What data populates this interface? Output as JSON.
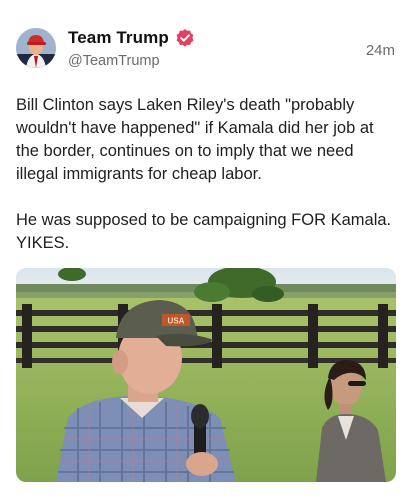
{
  "post": {
    "author": {
      "display_name": "Team Trump",
      "handle": "@TeamTrump",
      "verified_icon": "verified-badge-icon",
      "badge_color": "#e4405f",
      "avatar_icon": "profile-avatar"
    },
    "timestamp": "24m",
    "text": {
      "paragraph_1": "Bill Clinton says Laken Riley's death \"probably wouldn't have happened\" if Kamala did her job at the border, continues on to imply that we need illegal immigrants for cheap labor.",
      "paragraph_2": "He was supposed to be campaigning FOR Kamala. YIKES."
    },
    "media": {
      "type": "video-still",
      "cap_patch_text": "USA"
    }
  }
}
